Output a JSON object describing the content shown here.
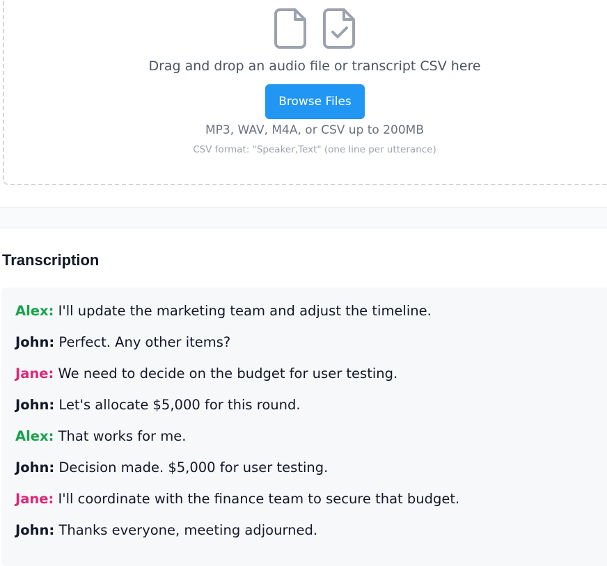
{
  "upload": {
    "icons": [
      "file-icon",
      "file-check-icon"
    ],
    "drop_text": "Drag and drop an audio file or transcript CSV here",
    "browse_label": "Browse Files",
    "formats_text": "MP3, WAV, M4A, or CSV up to 200MB",
    "csv_hint": "CSV format: \"Speaker,Text\" (one line per utterance)"
  },
  "transcription": {
    "title": "Transcription",
    "utterances": [
      {
        "speaker": "Alex:",
        "text": " I'll update the marketing team and adjust the timeline.",
        "color_class": "alex"
      },
      {
        "speaker": "John:",
        "text": " Perfect. Any other items?",
        "color_class": "john"
      },
      {
        "speaker": "Jane:",
        "text": " We need to decide on the budget for user testing.",
        "color_class": "jane"
      },
      {
        "speaker": "John:",
        "text": " Let's allocate $5,000 for this round.",
        "color_class": "john"
      },
      {
        "speaker": "Alex:",
        "text": " That works for me.",
        "color_class": "alex"
      },
      {
        "speaker": "John:",
        "text": " Decision made. $5,000 for user testing.",
        "color_class": "john"
      },
      {
        "speaker": "Jane:",
        "text": " I'll coordinate with the finance team to secure that budget.",
        "color_class": "jane"
      },
      {
        "speaker": "John:",
        "text": " Thanks everyone, meeting adjourned.",
        "color_class": "john"
      }
    ]
  },
  "colors": {
    "accent": "#2196f3",
    "alex": "#16a34a",
    "jane": "#db2777",
    "john": "#111827"
  }
}
